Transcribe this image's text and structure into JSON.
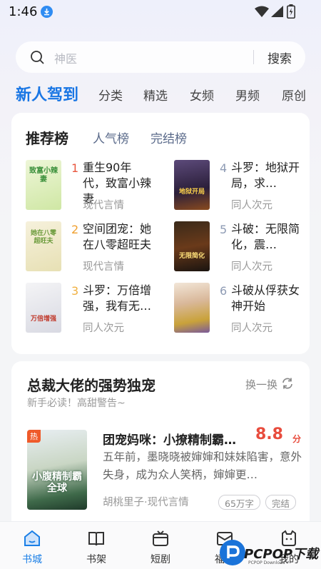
{
  "status_bar": {
    "time": "1:46"
  },
  "search": {
    "placeholder": "神医",
    "button": "搜索"
  },
  "tabs": [
    "新人驾到",
    "分类",
    "精选",
    "女频",
    "男频",
    "原创"
  ],
  "ranking": {
    "tabs": [
      "推荐榜",
      "人气榜",
      "完结榜"
    ],
    "books": [
      {
        "rank": "1",
        "title": "重生90年代，致富小辣妻",
        "category": "现代言情",
        "cover_text": "致富小辣妻"
      },
      {
        "rank": "2",
        "title": "空间团宠：她在八零超旺夫",
        "category": "现代言情",
        "cover_text": "她在八零超旺夫"
      },
      {
        "rank": "3",
        "title": "斗罗：万倍增强，我有无…",
        "category": "同人次元",
        "cover_text": "万倍增强"
      },
      {
        "rank": "4",
        "title": "斗罗：地狱开局，求…",
        "category": "同人次元",
        "cover_text": "地狱开局"
      },
      {
        "rank": "5",
        "title": "斗破：无限简化，震…",
        "category": "同人次元",
        "cover_text": "无限简化"
      },
      {
        "rank": "6",
        "title": "斗破从俘获女神开始",
        "category": "同人次元",
        "cover_text": ""
      }
    ]
  },
  "section": {
    "title": "总裁大佬的强势独宠",
    "subtitle": "新手必读！高甜警告~",
    "refresh": "换一换",
    "featured": {
      "badge": "热",
      "cover_text": "小腹精制霸全球",
      "title": "团宠妈咪：小撩精制霸…",
      "score": "8.8",
      "score_unit": "分",
      "description": "五年前，墨晓晓被婶婶和妹妹陷害，意外失身，成为众人笑柄，婶婶更…",
      "meta": "胡桃里子·现代言情",
      "tags": [
        "65万字",
        "完结"
      ]
    }
  },
  "bottom_nav": [
    "书城",
    "书架",
    "短剧",
    "福利",
    "我的"
  ],
  "watermark": {
    "text": "PCPOP下载",
    "sub": "PCPOP Download"
  },
  "colors": {
    "accent": "#1976e4",
    "rank_top": "#e9573f",
    "rank_other": "#8e9bb4",
    "score": "#e84c3d"
  }
}
